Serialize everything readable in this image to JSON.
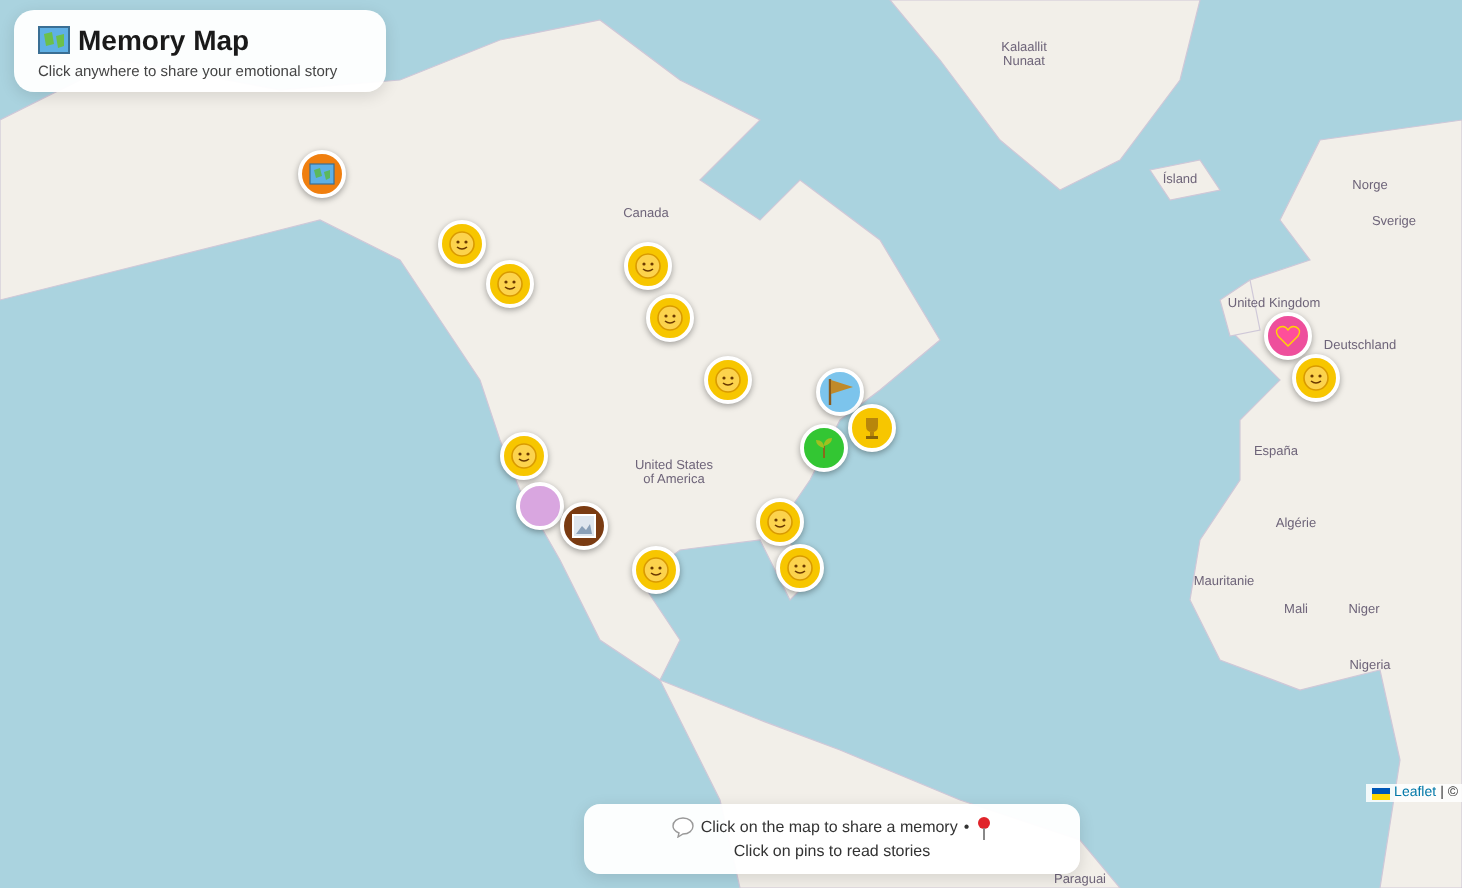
{
  "header": {
    "title": "Memory Map",
    "subtitle": "Click anywhere to share your emotional story"
  },
  "map_labels": [
    "Kalaallit\nNunaat",
    "Ísland",
    "Norge",
    "Sverige",
    "United Kingdom",
    "Deutschland",
    "España",
    "Algérie",
    "Mauritanie",
    "Mali",
    "Niger",
    "Nigeria",
    "Canada",
    "United States\nof America",
    "Paraguai"
  ],
  "pins": [
    {
      "kind": "map",
      "color": "#f07f0f"
    },
    {
      "kind": "smile",
      "color": "#f7c600"
    },
    {
      "kind": "smile",
      "color": "#f7c600"
    },
    {
      "kind": "smile",
      "color": "#f7c600"
    },
    {
      "kind": "smile",
      "color": "#f7c600"
    },
    {
      "kind": "smile",
      "color": "#f7c600"
    },
    {
      "kind": "sky",
      "color": "#7cc4ec"
    },
    {
      "kind": "trophy",
      "color": "#f7c600"
    },
    {
      "kind": "plant",
      "color": "#33c633"
    },
    {
      "kind": "smile",
      "color": "#f7c600"
    },
    {
      "kind": "blank",
      "color": "#d9a6e0"
    },
    {
      "kind": "frame",
      "color": "#7a3b12"
    },
    {
      "kind": "smile",
      "color": "#f7c600"
    },
    {
      "kind": "smile",
      "color": "#f7c600"
    },
    {
      "kind": "smile",
      "color": "#f7c600"
    },
    {
      "kind": "heart",
      "color": "#ee4f9c"
    },
    {
      "kind": "smile",
      "color": "#f7c600"
    }
  ],
  "hint": {
    "part_1": "Click on the map to share a memory",
    "separator": "•",
    "part_2": "Click on pins to read stories"
  },
  "attribution": {
    "link": "Leaflet",
    "rest": "| ©"
  }
}
